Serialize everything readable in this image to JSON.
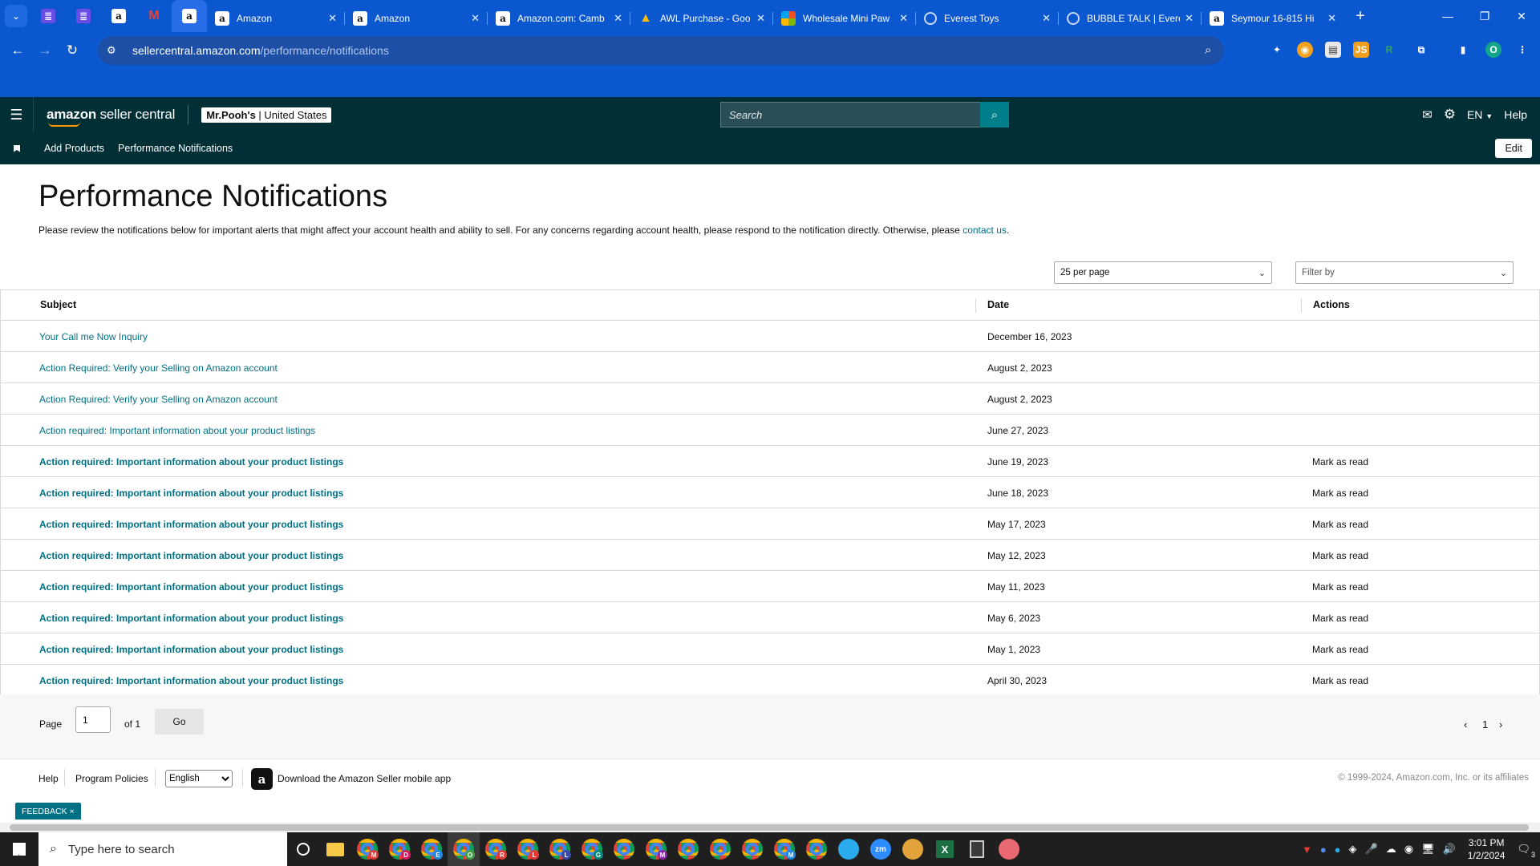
{
  "browser": {
    "tabs": [
      {
        "title": "Amazon",
        "active": false
      },
      {
        "title": "Amazon",
        "active": false
      },
      {
        "title": "Amazon.com: Camb",
        "active": false
      },
      {
        "title": "AWL Purchase - Goo",
        "active": false
      },
      {
        "title": "Wholesale Mini Paw",
        "active": false
      },
      {
        "title": "Everest Toys",
        "active": false
      },
      {
        "title": "BUBBLE TALK | Evere",
        "active": false
      },
      {
        "title": "Seymour 16-815 Hi",
        "active": false
      }
    ],
    "url_host": "sellercentral.amazon.com",
    "url_path": "/performance/notifications",
    "profile_initial": "O",
    "extensions": [
      "puzzle-ext",
      "orange-circle-ext",
      "screenshot-ext",
      "js-ext",
      "r-ext",
      "extensions-icon"
    ]
  },
  "header": {
    "logo_light": "amazon",
    "logo_rest": " seller central",
    "account_name": "Mr.Pooh's",
    "account_region": "United States",
    "search_placeholder": "Search",
    "language": "EN",
    "help": "Help"
  },
  "subnav": {
    "links": [
      "Add Products",
      "Performance Notifications"
    ],
    "edit": "Edit"
  },
  "main": {
    "title": "Performance Notifications",
    "description": "Please review the notifications below for important alerts that might affect your account health and ability to sell. For any concerns regarding account health, please respond to the notification directly. Otherwise, please ",
    "contact_link": "contact us",
    "description_end": ".",
    "per_page": "25 per page",
    "filter_by": "Filter by",
    "columns": {
      "subject": "Subject",
      "date": "Date",
      "actions": "Actions"
    },
    "rows": [
      {
        "subject": "Your Call me Now Inquiry",
        "date": "December 16, 2023",
        "action": "",
        "unread": false
      },
      {
        "subject": "Action Required: Verify your Selling on Amazon account",
        "date": "August 2, 2023",
        "action": "",
        "unread": false
      },
      {
        "subject": "Action Required: Verify your Selling on Amazon account",
        "date": "August 2, 2023",
        "action": "",
        "unread": false
      },
      {
        "subject": "Action required: Important information about your product listings",
        "date": "June 27, 2023",
        "action": "",
        "unread": false
      },
      {
        "subject": "Action required: Important information about your product listings",
        "date": "June 19, 2023",
        "action": "Mark as read",
        "unread": true
      },
      {
        "subject": "Action required: Important information about your product listings",
        "date": "June 18, 2023",
        "action": "Mark as read",
        "unread": true
      },
      {
        "subject": "Action required: Important information about your product listings",
        "date": "May 17, 2023",
        "action": "Mark as read",
        "unread": true
      },
      {
        "subject": "Action required: Important information about your product listings",
        "date": "May 12, 2023",
        "action": "Mark as read",
        "unread": true
      },
      {
        "subject": "Action required: Important information about your product listings",
        "date": "May 11, 2023",
        "action": "Mark as read",
        "unread": true
      },
      {
        "subject": "Action required: Important information about your product listings",
        "date": "May 6, 2023",
        "action": "Mark as read",
        "unread": true
      },
      {
        "subject": "Action required: Important information about your product listings",
        "date": "May 1, 2023",
        "action": "Mark as read",
        "unread": true
      },
      {
        "subject": "Action required: Important information about your product listings",
        "date": "April 30, 2023",
        "action": "Mark as read",
        "unread": true
      }
    ]
  },
  "pagination": {
    "label": "Page",
    "current": "1",
    "of_label": "of 1",
    "go": "Go",
    "page_number": "1"
  },
  "footer": {
    "help": "Help",
    "program_policies": "Program Policies",
    "language": "English",
    "app_text": "Download the Amazon Seller mobile app",
    "copyright": "© 1999-2024, Amazon.com, Inc. or its affiliates",
    "feedback": "FEEDBACK"
  },
  "taskbar": {
    "search_placeholder": "Type here to search",
    "time": "3:01 PM",
    "date": "1/2/2024",
    "notifications": "3",
    "zoom_label": "zm"
  },
  "colors": {
    "chrome_blue": "#0b57d0",
    "seller_header": "#002f36",
    "link_teal": "#007185",
    "search_button": "#007e8a",
    "amazon_orange": "#ff9900"
  }
}
